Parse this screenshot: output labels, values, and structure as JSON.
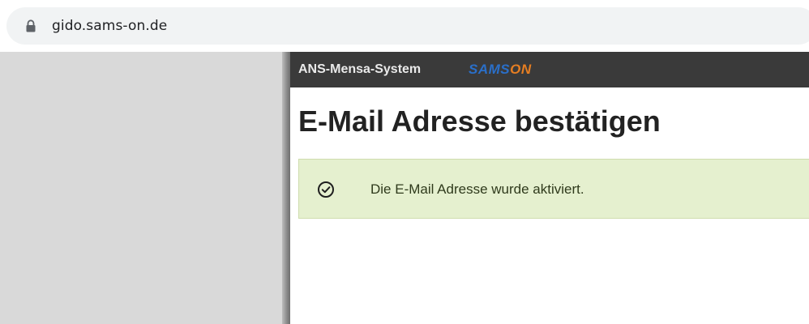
{
  "browser": {
    "url": "gido.sams-on.de",
    "lock_icon": "lock-icon"
  },
  "header": {
    "app_title": "ANS-Mensa-System",
    "brand_part1": "SAMS",
    "brand_part2": "ON",
    "colors": {
      "header_bg": "#3a3a3a",
      "brand_blue": "#2a6fc9",
      "brand_orange": "#e67e22"
    }
  },
  "main": {
    "page_title": "E-Mail Adresse bestätigen",
    "alert": {
      "icon": "check-circle-icon",
      "message": "Die E-Mail Adresse wurde aktiviert.",
      "bg_color": "#e5f0cf"
    }
  }
}
